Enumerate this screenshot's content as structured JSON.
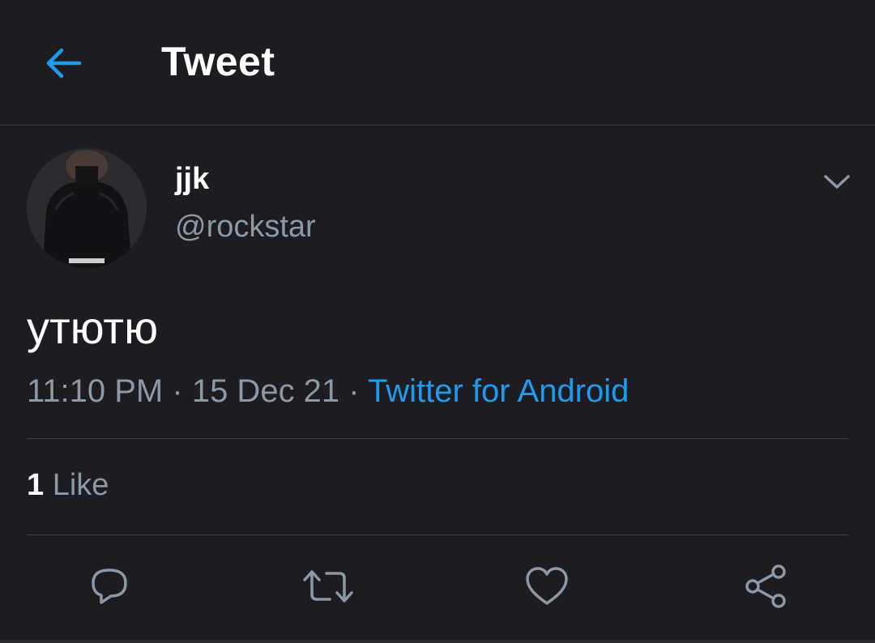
{
  "header": {
    "title": "Tweet",
    "back_icon": "arrow-left-icon"
  },
  "tweet": {
    "author": {
      "display_name": "jjk",
      "handle": "@rockstar"
    },
    "text": "утютю",
    "time": "11:10 PM",
    "date": "15 Dec 21",
    "separator": "·",
    "source": "Twitter for Android"
  },
  "stats": {
    "likes_count": "1",
    "likes_label": "Like"
  },
  "actions": [
    {
      "name": "reply",
      "icon": "reply-icon"
    },
    {
      "name": "retweet",
      "icon": "retweet-icon"
    },
    {
      "name": "like",
      "icon": "heart-icon"
    },
    {
      "name": "share",
      "icon": "share-icon"
    }
  ],
  "colors": {
    "background": "#1d1c20",
    "accent": "#1d9bf0",
    "secondary_text": "#8b98a5",
    "divider": "#3a3a3f"
  }
}
